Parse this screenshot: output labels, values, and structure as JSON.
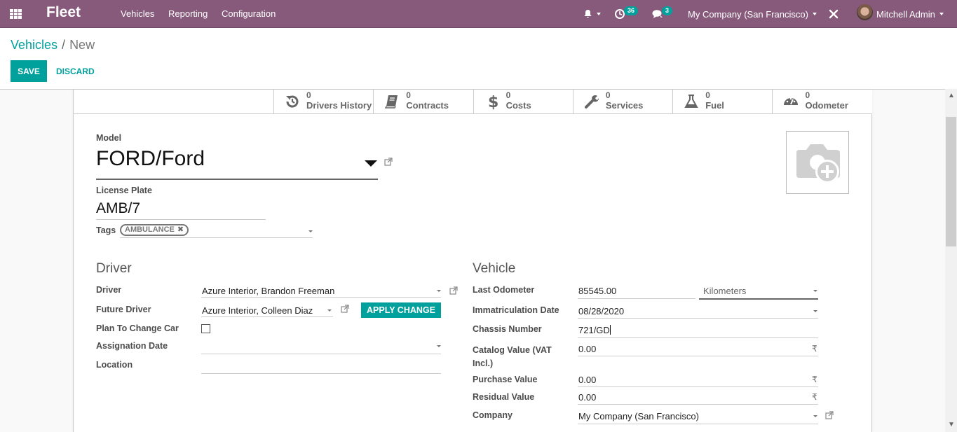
{
  "navbar": {
    "app_name": "Fleet",
    "menus": [
      "Vehicles",
      "Reporting",
      "Configuration"
    ],
    "activity_count": "36",
    "message_count": "3",
    "company": "My Company (San Francisco)",
    "user": "Mitchell Admin",
    "brand_color": "#875a7b"
  },
  "breadcrumb": {
    "parent": "Vehicles",
    "separator": "/",
    "current": "New"
  },
  "actions": {
    "save": "SAVE",
    "discard": "DISCARD",
    "accent_color": "#00a09d"
  },
  "smart_buttons": [
    {
      "icon": "history-icon",
      "value": "0",
      "label": "Drivers History"
    },
    {
      "icon": "book-icon",
      "value": "0",
      "label": "Contracts"
    },
    {
      "icon": "dollar-icon",
      "value": "0",
      "label": "Costs"
    },
    {
      "icon": "wrench-icon",
      "value": "0",
      "label": "Services"
    },
    {
      "icon": "flask-icon",
      "value": "0",
      "label": "Fuel"
    },
    {
      "icon": "tachometer-icon",
      "value": "0",
      "label": "Odometer"
    }
  ],
  "form": {
    "model_label": "Model",
    "model_value": "FORD/Ford",
    "plate_label": "License Plate",
    "plate_value": "AMB/7",
    "tags_label": "Tags",
    "tags": [
      "AMBULANCE"
    ],
    "driver_section": {
      "title": "Driver",
      "driver_label": "Driver",
      "driver_value": "Azure Interior, Brandon Freeman",
      "future_driver_label": "Future Driver",
      "future_driver_value": "Azure Interior, Colleen Diaz",
      "apply_change": "APPLY CHANGE",
      "plan_change_label": "Plan To Change Car",
      "plan_change_checked": false,
      "assignation_label": "Assignation Date",
      "assignation_value": "",
      "location_label": "Location",
      "location_value": ""
    },
    "vehicle_section": {
      "title": "Vehicle",
      "odometer_label": "Last Odometer",
      "odometer_value": "85545.00",
      "odometer_unit": "Kilometers",
      "immat_label": "Immatriculation Date",
      "immat_value": "08/28/2020",
      "chassis_label": "Chassis Number",
      "chassis_value": "721/GD",
      "catalog_label": "Catalog Value (VAT Incl.)",
      "catalog_value": "0.00",
      "purchase_label": "Purchase Value",
      "purchase_value": "0.00",
      "residual_label": "Residual Value",
      "residual_value": "0.00",
      "company_label": "Company",
      "company_value": "My Company (San Francisco)",
      "currency_symbol": "₹"
    }
  }
}
